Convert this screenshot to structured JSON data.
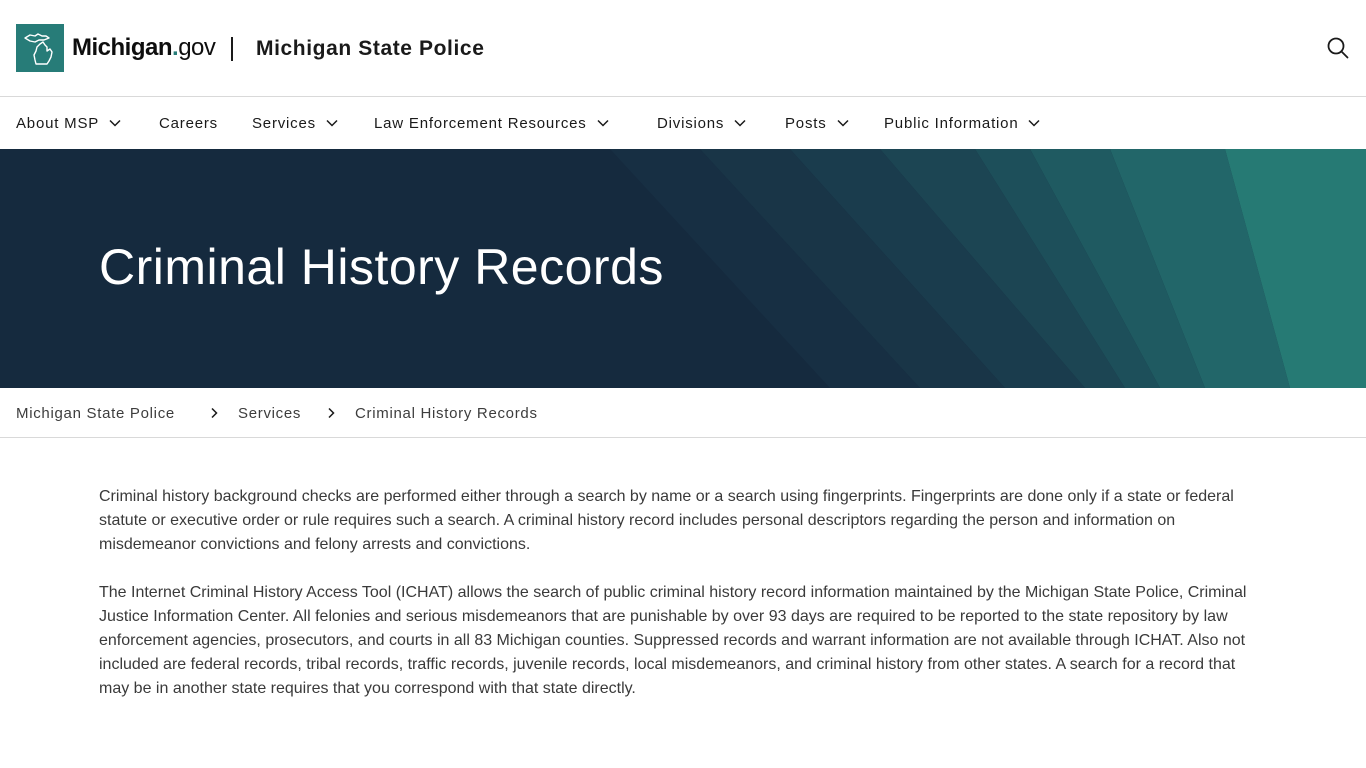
{
  "header": {
    "logo_brand": "Michigan",
    "logo_dot": ".",
    "logo_suffix": "gov",
    "agency_name": "Michigan State Police",
    "icons": {
      "logo": "michigan-state-outline-icon",
      "search": "search-icon"
    }
  },
  "nav": {
    "items": [
      {
        "label": "About MSP",
        "has_dropdown": true
      },
      {
        "label": "Careers",
        "has_dropdown": false
      },
      {
        "label": "Services",
        "has_dropdown": true
      },
      {
        "label": "Law Enforcement Resources",
        "has_dropdown": true
      },
      {
        "label": "Divisions",
        "has_dropdown": true
      },
      {
        "label": "Posts",
        "has_dropdown": true
      },
      {
        "label": "Public Information",
        "has_dropdown": true
      }
    ],
    "dropdown_icon": "chevron-down-icon"
  },
  "hero": {
    "title": "Criminal History Records"
  },
  "breadcrumb": {
    "items": [
      "Michigan State Police",
      "Services",
      "Criminal History Records"
    ],
    "separator_icon": "chevron-right-icon"
  },
  "content": {
    "paragraphs": [
      "Criminal history background checks are performed either through a search by name or a search using fingerprints. Fingerprints are done only if a state or federal statute or executive order or rule requires such a search. A criminal history record includes personal descriptors regarding the person and information on misdemeanor convictions and felony arrests and convictions.",
      "The Internet Criminal History Access Tool (ICHAT) allows the search of public criminal history record information maintained by the Michigan State Police, Criminal Justice Information Center. All felonies and serious misdemeanors that are punishable by over 93 days are required to be reported to the state repository by law enforcement agencies, prosecutors, and courts in all 83 Michigan counties. Suppressed records and warrant information are not available through ICHAT. Also not included are federal records, tribal records, traffic records, juvenile records, local misdemeanors, and criminal history from other states. A search for a record that may be in another state requires that you correspond with that state directly."
    ]
  },
  "colors": {
    "brand_teal": "#277c78",
    "hero_navy": "#152a3e",
    "text_dark": "#1a1a1a",
    "text_body": "#3a3a3a",
    "divider": "#d9d9d9"
  }
}
